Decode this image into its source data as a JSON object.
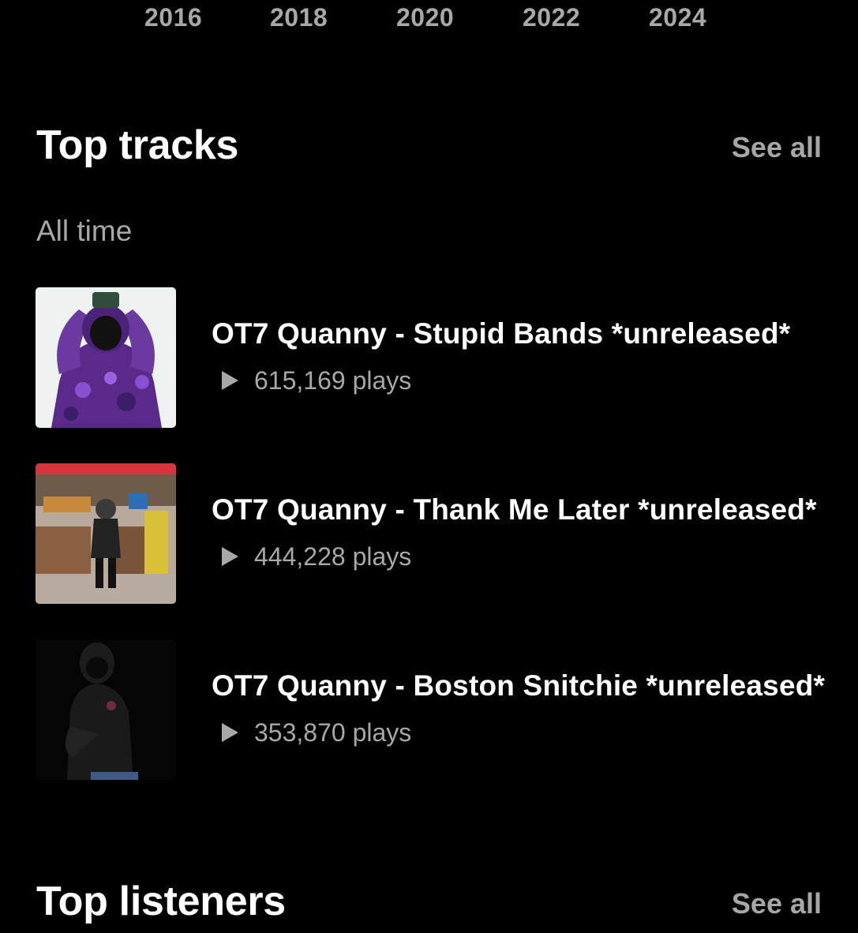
{
  "timeline": {
    "years": [
      "2016",
      "2018",
      "2020",
      "2022",
      "2024"
    ]
  },
  "top_tracks": {
    "title": "Top tracks",
    "see_all": "See all",
    "period": "All time",
    "items": [
      {
        "title": "OT7 Quanny - Stupid Bands *unreleased*",
        "plays": "615,169 plays"
      },
      {
        "title": "OT7 Quanny - Thank Me Later *unreleased*",
        "plays": "444,228 plays"
      },
      {
        "title": "OT7 Quanny - Boston Snitchie *unreleased*",
        "plays": "353,870 plays"
      }
    ]
  },
  "top_listeners": {
    "title": "Top listeners",
    "see_all": "See all"
  },
  "colors": {
    "background": "#000000",
    "primary_text": "#ffffff",
    "secondary_text": "#a8a8a8"
  },
  "icons": {
    "play": "play-triangle-icon"
  }
}
